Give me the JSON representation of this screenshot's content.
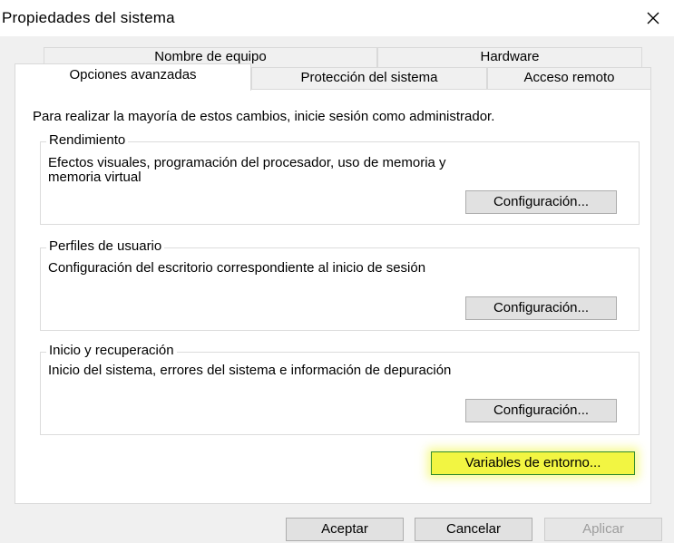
{
  "window": {
    "title": "Propiedades del sistema"
  },
  "tabs": {
    "row1": [
      {
        "label": "Nombre de equipo"
      },
      {
        "label": "Hardware"
      }
    ],
    "row2": [
      {
        "label": "Opciones avanzadas",
        "active": true
      },
      {
        "label": "Protección del sistema"
      },
      {
        "label": "Acceso remoto"
      }
    ]
  },
  "content": {
    "intro": "Para realizar la mayoría de estos cambios, inicie sesión como administrador.",
    "groups": [
      {
        "legend": "Rendimiento",
        "desc_line1": "Efectos visuales, programación del procesador, uso de memoria y",
        "desc_line2": "memoria virtual",
        "button": "Configuración..."
      },
      {
        "legend": "Perfiles de usuario",
        "desc_line1": "Configuración del escritorio correspondiente al inicio de sesión",
        "button": "Configuración..."
      },
      {
        "legend": "Inicio y recuperación",
        "desc_line1": "Inicio del sistema, errores del sistema e información de depuración",
        "button": "Configuración..."
      }
    ],
    "env_button": "Variables de entorno..."
  },
  "footer": {
    "ok": "Aceptar",
    "cancel": "Cancelar",
    "apply": "Aplicar"
  },
  "colors": {
    "highlight": "#f2f542",
    "highlight_border": "#2f8a2f",
    "disabled_text": "#9d9d9d"
  }
}
